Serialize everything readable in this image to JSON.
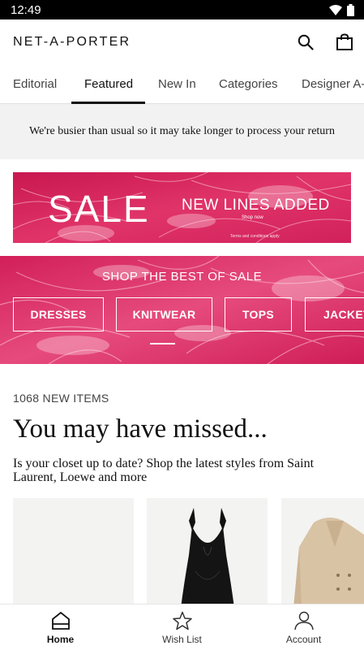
{
  "status_bar": {
    "time": "12:49"
  },
  "header": {
    "logo": "NET-A-PORTER",
    "icons": [
      "search-icon",
      "shopping-bag-icon"
    ]
  },
  "tabs": [
    {
      "label": "Editorial",
      "active": false
    },
    {
      "label": "Featured",
      "active": true
    },
    {
      "label": "New In",
      "active": false
    },
    {
      "label": "Categories",
      "active": false
    },
    {
      "label": "Designer A-Z",
      "active": false
    }
  ],
  "notice": {
    "text": "We're busier than usual so it may take longer to process your return"
  },
  "sale_banner": {
    "title": "SALE",
    "subtitle": "NEW LINES ADDED",
    "cta": "Shop now",
    "terms": "Terms and conditions apply"
  },
  "best_of_sale": {
    "title": "SHOP THE BEST OF SALE",
    "categories": [
      "DRESSES",
      "KNITWEAR",
      "TOPS",
      "JACKETS"
    ]
  },
  "new_items": {
    "count_label": "1068 NEW ITEMS",
    "headline": "You may have missed...",
    "description": "Is your closet up to date? Shop the latest styles from Saint Laurent, Loewe and more"
  },
  "bottom_nav": [
    {
      "label": "Home",
      "icon": "home-icon",
      "active": true
    },
    {
      "label": "Wish List",
      "icon": "star-icon",
      "active": false
    },
    {
      "label": "Account",
      "icon": "person-icon",
      "active": false
    }
  ],
  "colors": {
    "accent_pink": "#d8265f",
    "background": "#ffffff",
    "notice_bg": "#f2f2f2"
  }
}
